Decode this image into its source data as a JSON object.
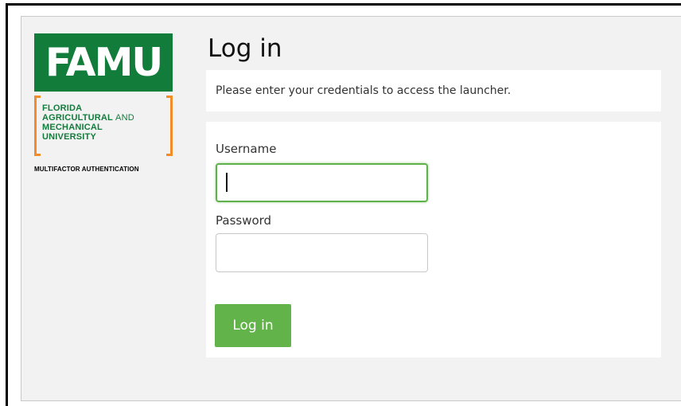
{
  "logo": {
    "wordmark": "FAMU",
    "line1": "FLORIDA",
    "line2": "AGRICULTURAL",
    "line2_and": "AND",
    "line3": "MECHANICAL",
    "line4": "UNIVERSITY",
    "tagline": "MULTIFACTOR AUTHENTICATION"
  },
  "page": {
    "title": "Log in",
    "notice": "Please enter your credentials to access the launcher."
  },
  "form": {
    "username_label": "Username",
    "username_value": "",
    "password_label": "Password",
    "password_value": "",
    "submit_label": "Log in"
  },
  "colors": {
    "brand_green": "#127c3b",
    "brand_orange": "#f28c28",
    "button_green": "#62b34a",
    "focus_green": "#5fb24b"
  }
}
